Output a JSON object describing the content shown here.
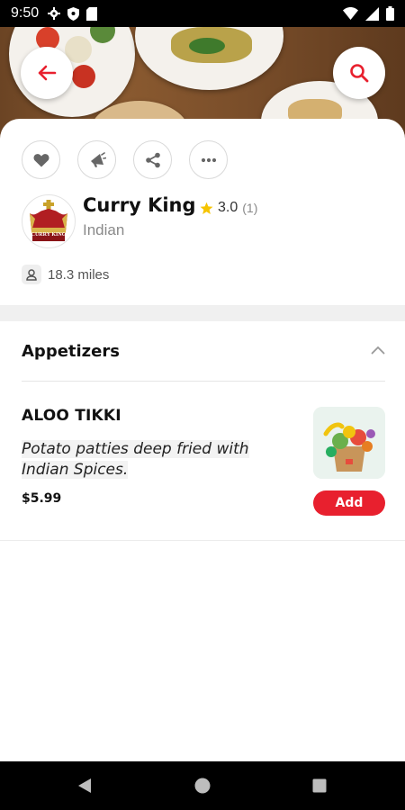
{
  "status_bar": {
    "time": "9:50"
  },
  "restaurant": {
    "name": "Curry King",
    "rating": "3.0",
    "rating_count": "(1)",
    "cuisine": "Indian",
    "distance": "18.3 miles",
    "logo_text": "CURRY KING"
  },
  "menu": {
    "section_title": "Appetizers",
    "items": [
      {
        "name": "ALOO TIKKI",
        "description": "Potato patties deep fried with Indian Spices.",
        "price": "$5.99",
        "add_label": "Add"
      }
    ]
  },
  "colors": {
    "accent": "#e8202e",
    "star": "#f6c400"
  },
  "icons": {
    "back": "arrow-left-icon",
    "search": "search-icon",
    "favorite": "heart-icon",
    "promote": "megaphone-icon",
    "share": "share-icon",
    "more": "more-icon",
    "location": "location-pin-icon",
    "collapse": "chevron-up-icon"
  }
}
